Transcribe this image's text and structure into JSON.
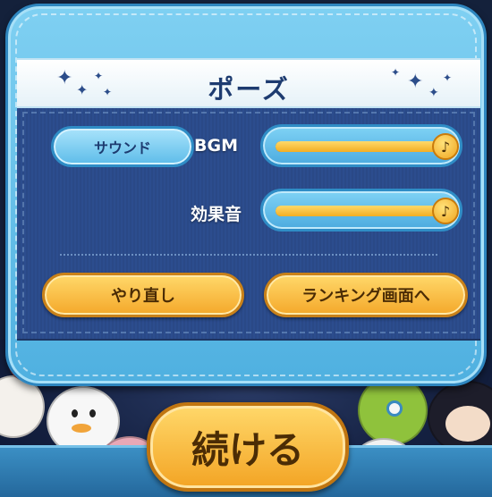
{
  "dialog": {
    "title": "ポーズ",
    "sound_button": "サウンド",
    "bgm_label": "BGM",
    "bgm_level": 1.0,
    "sfx_label": "効果音",
    "sfx_level": 1.0,
    "slider_knob_icon": "music-note-icon",
    "retry_button": "やり直し",
    "ranking_button": "ランキング画面へ"
  },
  "continue_button": "続ける",
  "colors": {
    "panel_blue": "#5fbde8",
    "inner_navy": "#2c4d8e",
    "button_yellow": "#f4a82a",
    "title_text": "#1d3b70"
  }
}
